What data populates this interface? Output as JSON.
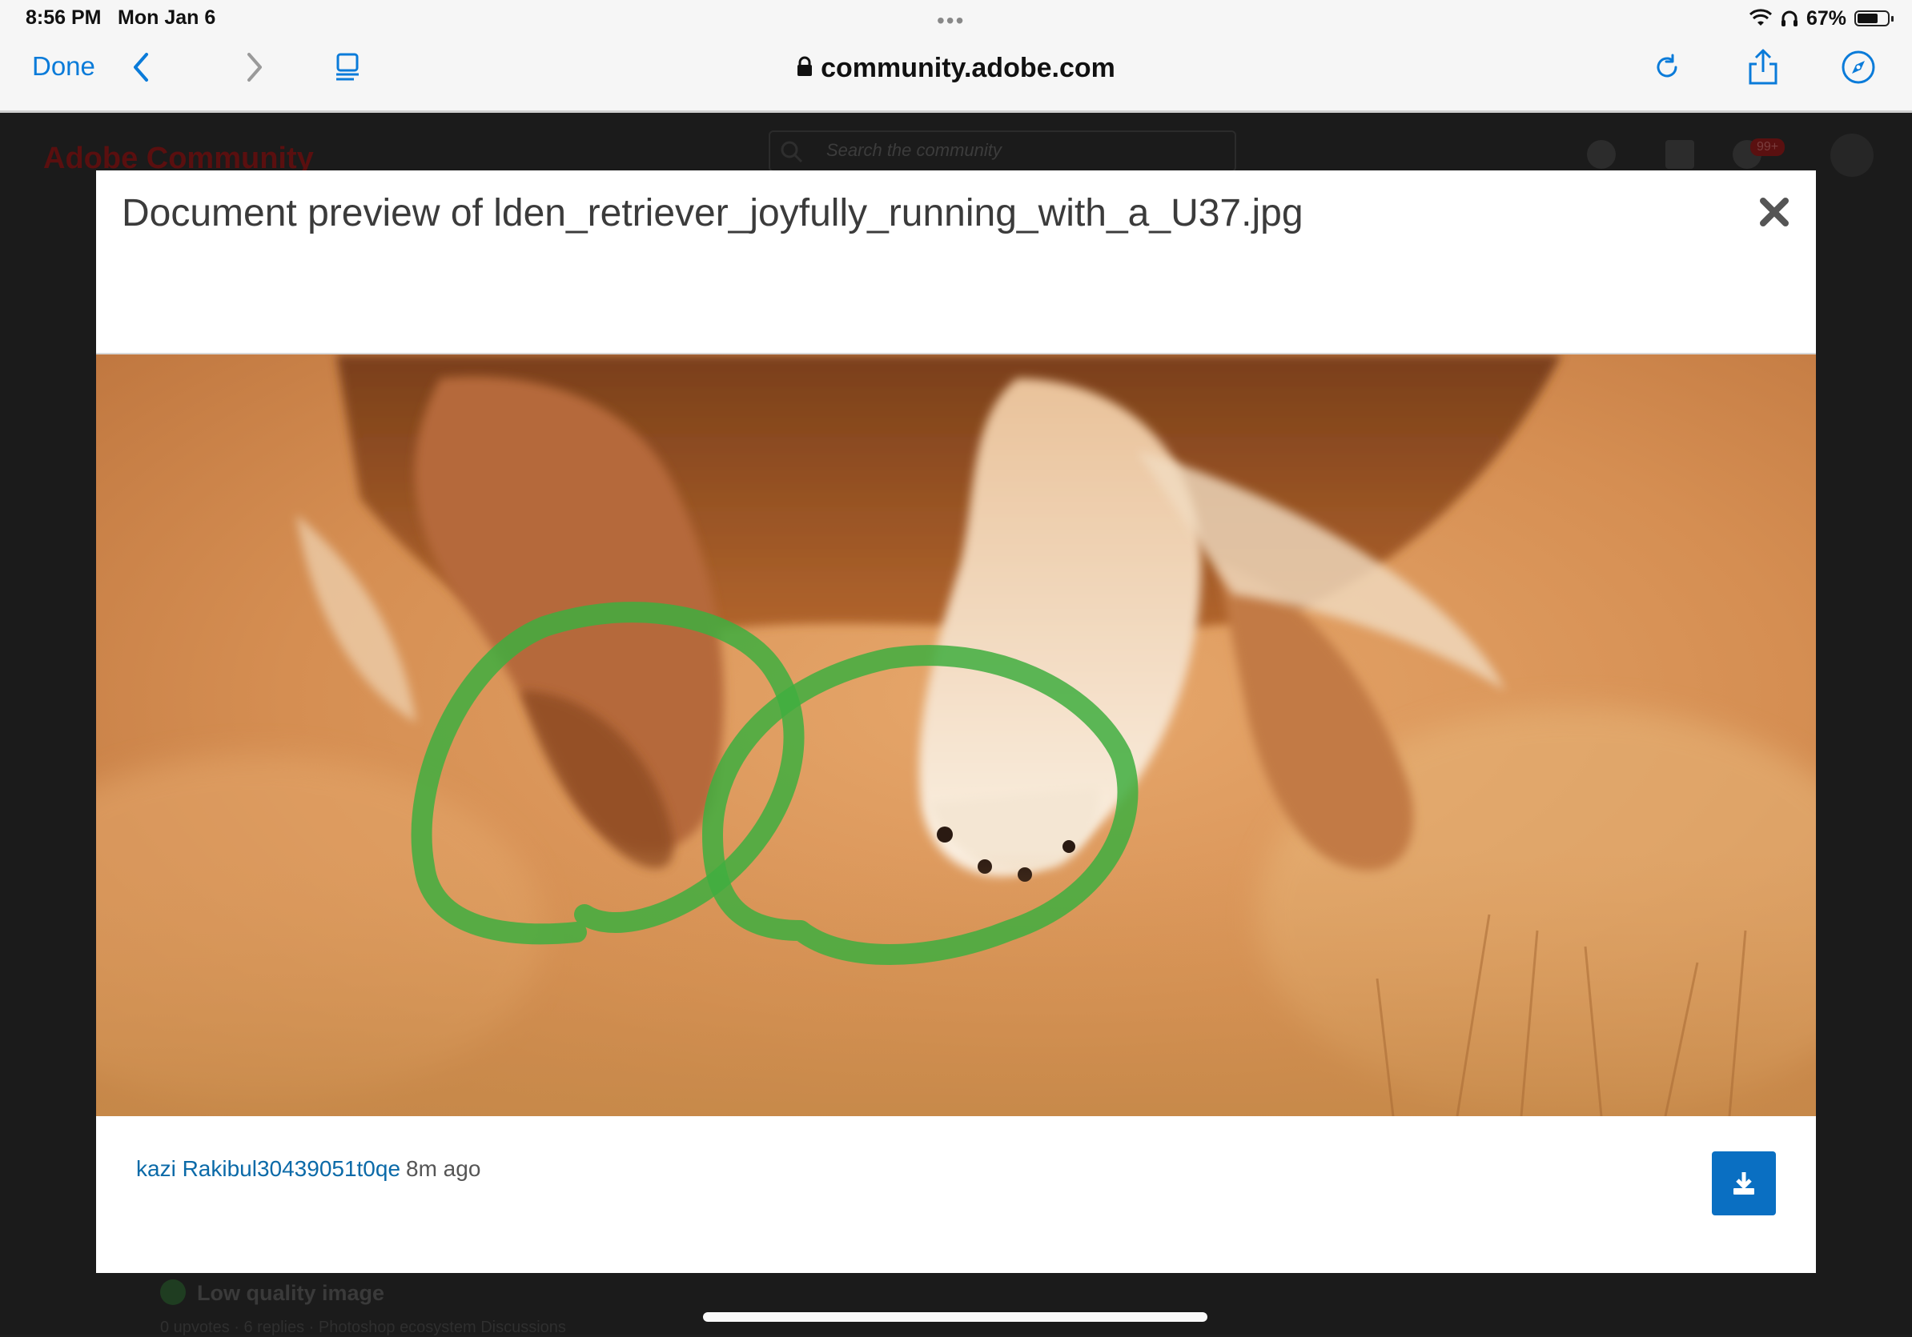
{
  "status_bar": {
    "time": "8:56 PM",
    "date": "Mon Jan 6",
    "dots": "•••",
    "battery": "67%",
    "battery_level": 0.67
  },
  "toolbar": {
    "done_label": "Done",
    "url": "community.adobe.com"
  },
  "background_page": {
    "logo": "Adobe Community",
    "search_placeholder": "Search the community",
    "notification_badge": "99+",
    "post_title": "Low quality image",
    "post_meta": "0 upvotes · 6 replies · Photoshop ecosystem Discussions"
  },
  "modal": {
    "title": "Document preview of lden_retriever_joyfully_running_with_a_U37.jpg",
    "author": "kazi Rakibul30439051t0qe",
    "time_ago": "8m ago"
  },
  "colors": {
    "accent": "#0a7bd9",
    "download_button": "#0a6fc2",
    "annotation_green": "#3fae3f"
  }
}
